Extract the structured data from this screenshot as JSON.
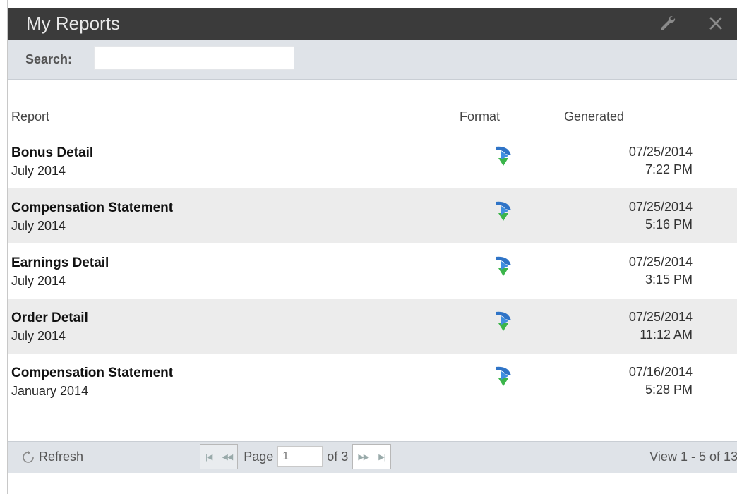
{
  "window": {
    "title": "My Reports"
  },
  "search": {
    "label": "Search:",
    "value": "",
    "placeholder": ""
  },
  "table": {
    "headers": {
      "report": "Report",
      "format": "Format",
      "generated": "Generated"
    },
    "rows": [
      {
        "name": "Bonus Detail",
        "period": "July 2014",
        "format_icon": "download-arrow-icon",
        "date": "07/25/2014",
        "time": "7:22 PM"
      },
      {
        "name": "Compensation Statement",
        "period": "July 2014",
        "format_icon": "download-arrow-icon",
        "date": "07/25/2014",
        "time": "5:16 PM"
      },
      {
        "name": "Earnings Detail",
        "period": "July 2014",
        "format_icon": "download-arrow-icon",
        "date": "07/25/2014",
        "time": "3:15 PM"
      },
      {
        "name": "Order Detail",
        "period": "July 2014",
        "format_icon": "download-arrow-icon",
        "date": "07/25/2014",
        "time": "11:12 AM"
      },
      {
        "name": "Compensation Statement",
        "period": "January 2014",
        "format_icon": "download-arrow-icon",
        "date": "07/16/2014",
        "time": "5:28 PM"
      }
    ]
  },
  "footer": {
    "refresh_label": "Refresh",
    "page_label": "Page",
    "page_value": "1",
    "page_of": "of 3",
    "view_count": "View 1 - 5 of 13"
  },
  "colors": {
    "titlebar_bg": "#3b3b3b",
    "toolbar_bg": "#dfe3e8",
    "row_alt": "#ececec",
    "icon_blue": "#2f74c7",
    "icon_green": "#3bb54a"
  }
}
